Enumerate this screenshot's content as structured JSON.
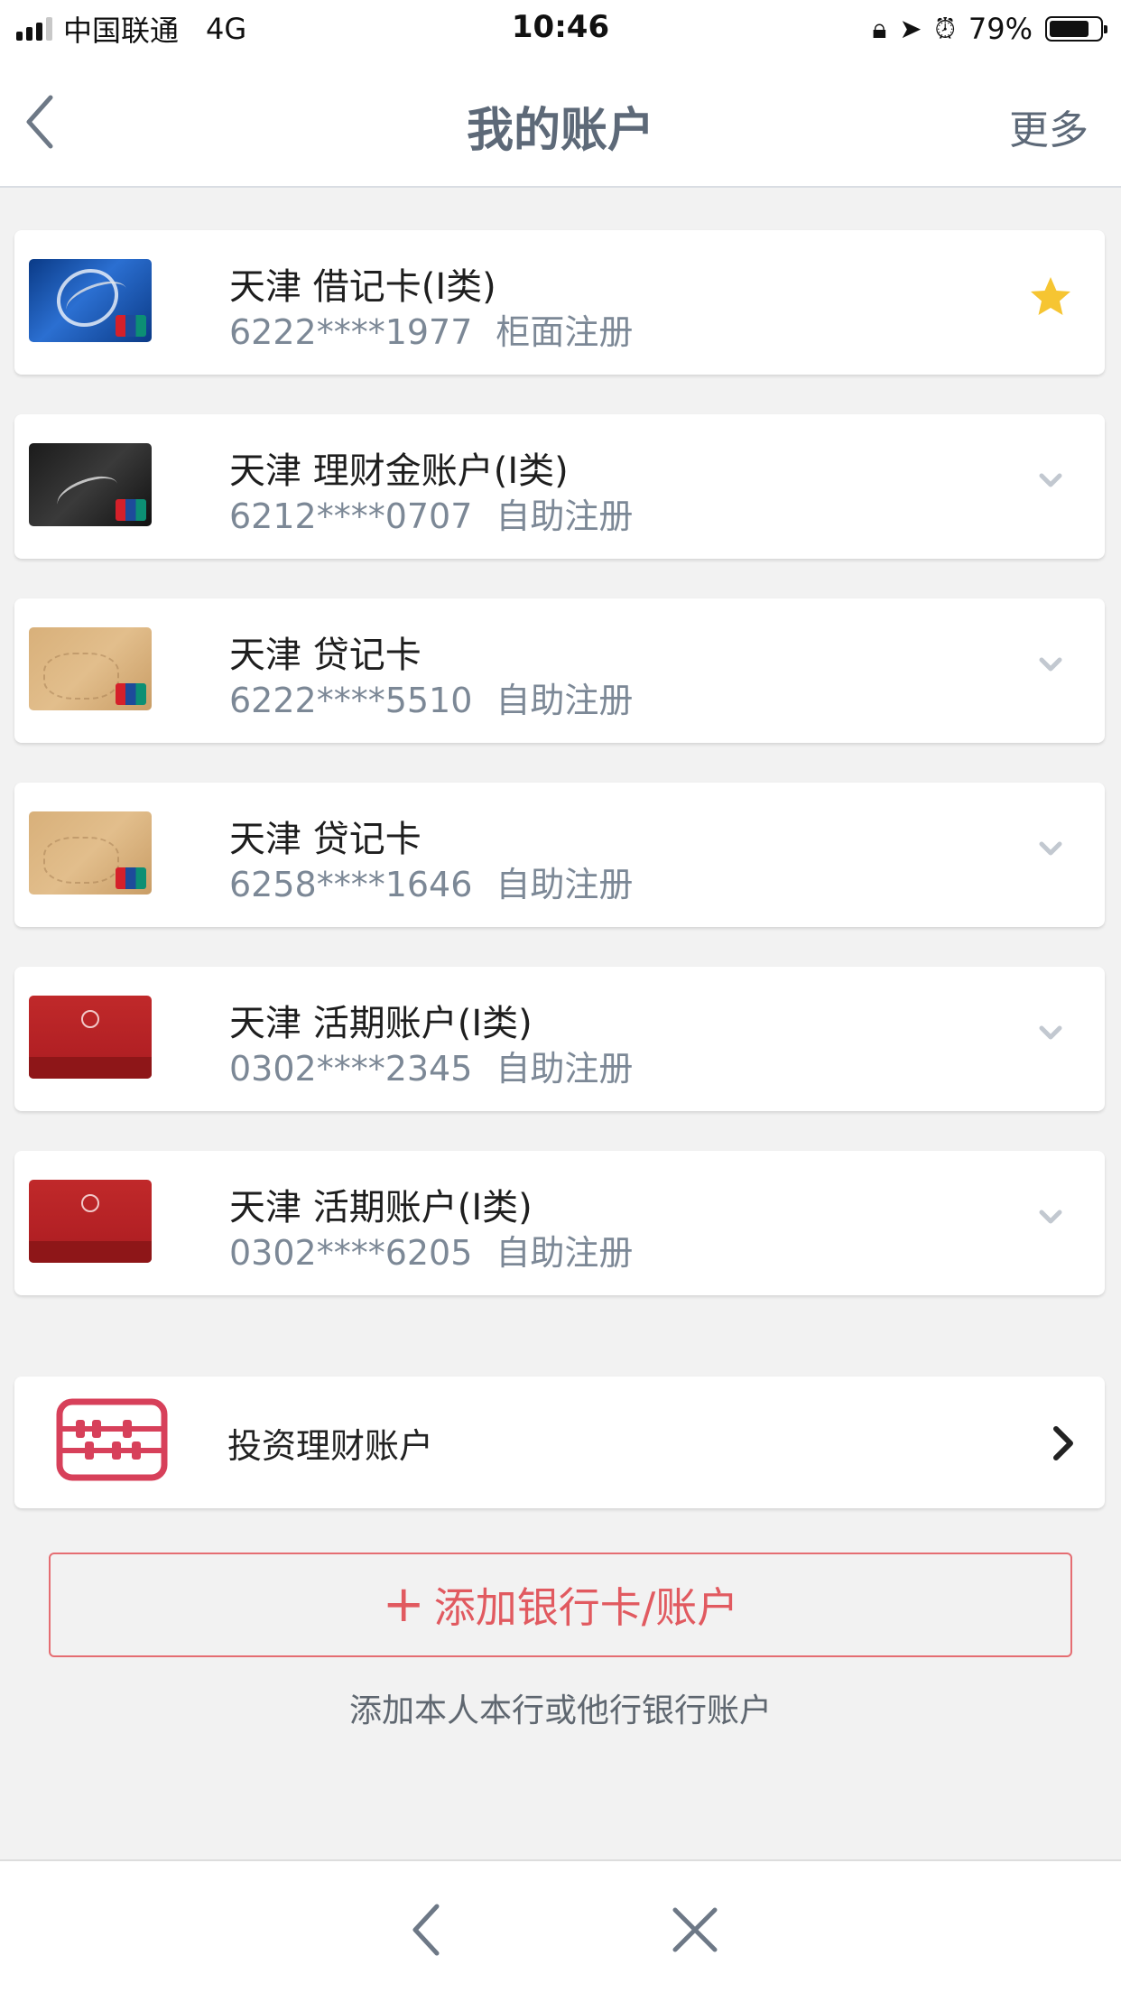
{
  "status_bar": {
    "carrier": "中国联通",
    "network": "4G",
    "time": "10:46",
    "battery": "79%",
    "battery_level": 0.79
  },
  "nav": {
    "title": "我的账户",
    "more": "更多"
  },
  "accounts": [
    {
      "name": "天津 借记卡(I类)",
      "number": "6222****1977",
      "registration": "柜面注册",
      "card_style": "blue",
      "right_icon": "star-icon"
    },
    {
      "name": "天津 理财金账户(I类)",
      "number": "6212****0707",
      "registration": "自助注册",
      "card_style": "black",
      "right_icon": "chevron-down-icon"
    },
    {
      "name": "天津 贷记卡",
      "number": "6222****5510",
      "registration": "自助注册",
      "card_style": "gold",
      "right_icon": "chevron-down-icon"
    },
    {
      "name": "天津 贷记卡",
      "number": "6258****1646",
      "registration": "自助注册",
      "card_style": "gold",
      "right_icon": "chevron-down-icon"
    },
    {
      "name": "天津 活期账户(I类)",
      "number": "0302****2345",
      "registration": "自助注册",
      "card_style": "red",
      "right_icon": "chevron-down-icon"
    },
    {
      "name": "天津 活期账户(I类)",
      "number": "0302****6205",
      "registration": "自助注册",
      "card_style": "red",
      "right_icon": "chevron-down-icon"
    }
  ],
  "invest": {
    "label": "投资理财账户",
    "icon": "abacus-icon"
  },
  "add": {
    "plus": "+",
    "label": "添加银行卡/账户",
    "hint": "添加本人本行或他行银行账户"
  },
  "colors": {
    "accent_red": "#e15a60",
    "title_gray": "#5d6978",
    "star_yellow": "#f6c532"
  }
}
